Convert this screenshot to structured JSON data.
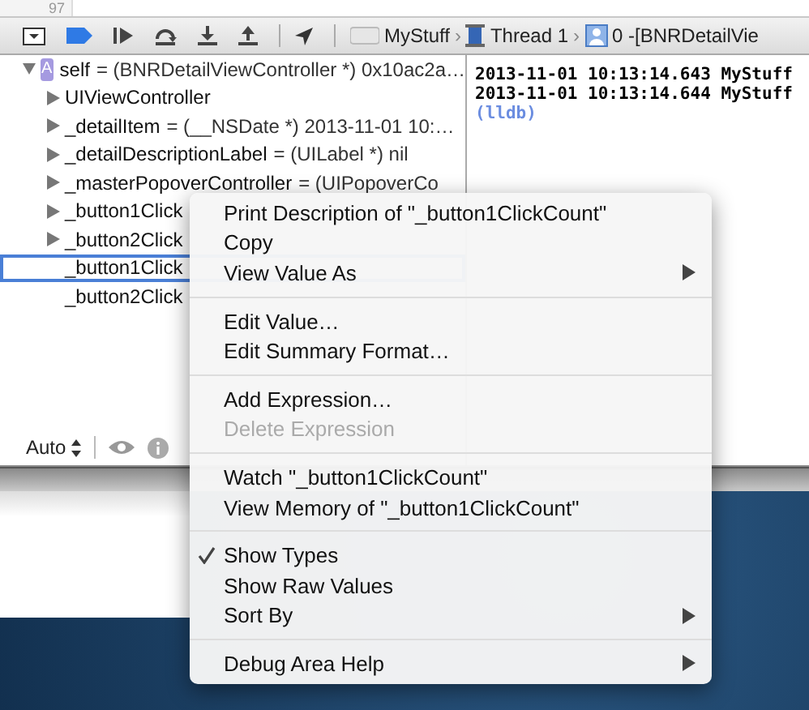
{
  "editor": {
    "line_number": "97"
  },
  "debug_bar": {
    "breadcrumbs": [
      {
        "kind": "app",
        "label": "MyStuff"
      },
      {
        "kind": "separator",
        "label": "›"
      },
      {
        "kind": "thread",
        "label": "Thread 1"
      },
      {
        "kind": "separator",
        "label": "›"
      },
      {
        "kind": "frame",
        "label": "0 -[BNRDetailVie"
      }
    ]
  },
  "variables": [
    {
      "kind": "group",
      "name": "self",
      "value": "= (BNRDetailViewController *) 0x10ac2a…",
      "expanded": true,
      "badge": "A",
      "selected": false
    },
    {
      "kind": "group",
      "name": "UIViewController",
      "expanded": false,
      "selected": false
    },
    {
      "kind": "group",
      "name": "_detailItem",
      "value": "= (__NSDate *) 2013-11-01 10:…",
      "expanded": false,
      "selected": false
    },
    {
      "kind": "group",
      "name": "_detailDescriptionLabel",
      "value": "= (UILabel *) nil",
      "expanded": false,
      "selected": false
    },
    {
      "kind": "group",
      "name": "_masterPopoverController",
      "value": "= (UIPopoverCo",
      "expanded": false,
      "selected": false
    },
    {
      "kind": "group",
      "name": "_button1Click",
      "expanded": false,
      "selected": false
    },
    {
      "kind": "group",
      "name": "_button2Click",
      "expanded": false,
      "selected": false
    },
    {
      "kind": "leaf",
      "name": "_button1Click",
      "selected": true
    },
    {
      "kind": "leaf",
      "name": "_button2Click",
      "selected": false
    }
  ],
  "variables_footer": {
    "scope": "Auto"
  },
  "console": {
    "lines": [
      {
        "kind": "log",
        "text": "2013-11-01 10:13:14.643 MyStuff"
      },
      {
        "kind": "log",
        "text": "2013-11-01 10:13:14.644 MyStuff"
      },
      {
        "kind": "prompt",
        "text": "(lldb)"
      }
    ]
  },
  "context_menu": {
    "items": [
      {
        "kind": "item",
        "label": "Print Description of \"_button1ClickCount\"",
        "disabled": false,
        "checked": false,
        "submenu": false
      },
      {
        "kind": "item",
        "label": "Copy",
        "disabled": false,
        "checked": false,
        "submenu": false
      },
      {
        "kind": "item",
        "label": "View Value As",
        "disabled": false,
        "checked": false,
        "submenu": true
      },
      {
        "kind": "separator"
      },
      {
        "kind": "item",
        "label": "Edit Value…",
        "disabled": false,
        "checked": false,
        "submenu": false
      },
      {
        "kind": "item",
        "label": "Edit Summary Format…",
        "disabled": false,
        "checked": false,
        "submenu": false
      },
      {
        "kind": "separator"
      },
      {
        "kind": "item",
        "label": "Add Expression…",
        "disabled": false,
        "checked": false,
        "submenu": false
      },
      {
        "kind": "item",
        "label": "Delete Expression",
        "disabled": true,
        "checked": false,
        "submenu": false
      },
      {
        "kind": "separator"
      },
      {
        "kind": "item",
        "label": "Watch \"_button1ClickCount\"",
        "disabled": false,
        "checked": false,
        "submenu": false
      },
      {
        "kind": "item",
        "label": "View Memory of \"_button1ClickCount\"",
        "disabled": false,
        "checked": false,
        "submenu": false
      },
      {
        "kind": "separator"
      },
      {
        "kind": "item",
        "label": "Show Types",
        "disabled": false,
        "checked": true,
        "submenu": false
      },
      {
        "kind": "item",
        "label": "Show Raw Values",
        "disabled": false,
        "checked": false,
        "submenu": false
      },
      {
        "kind": "item",
        "label": "Sort By",
        "disabled": false,
        "checked": false,
        "submenu": true
      },
      {
        "kind": "separator"
      },
      {
        "kind": "item",
        "label": "Debug Area Help",
        "disabled": false,
        "checked": false,
        "submenu": true
      }
    ]
  }
}
